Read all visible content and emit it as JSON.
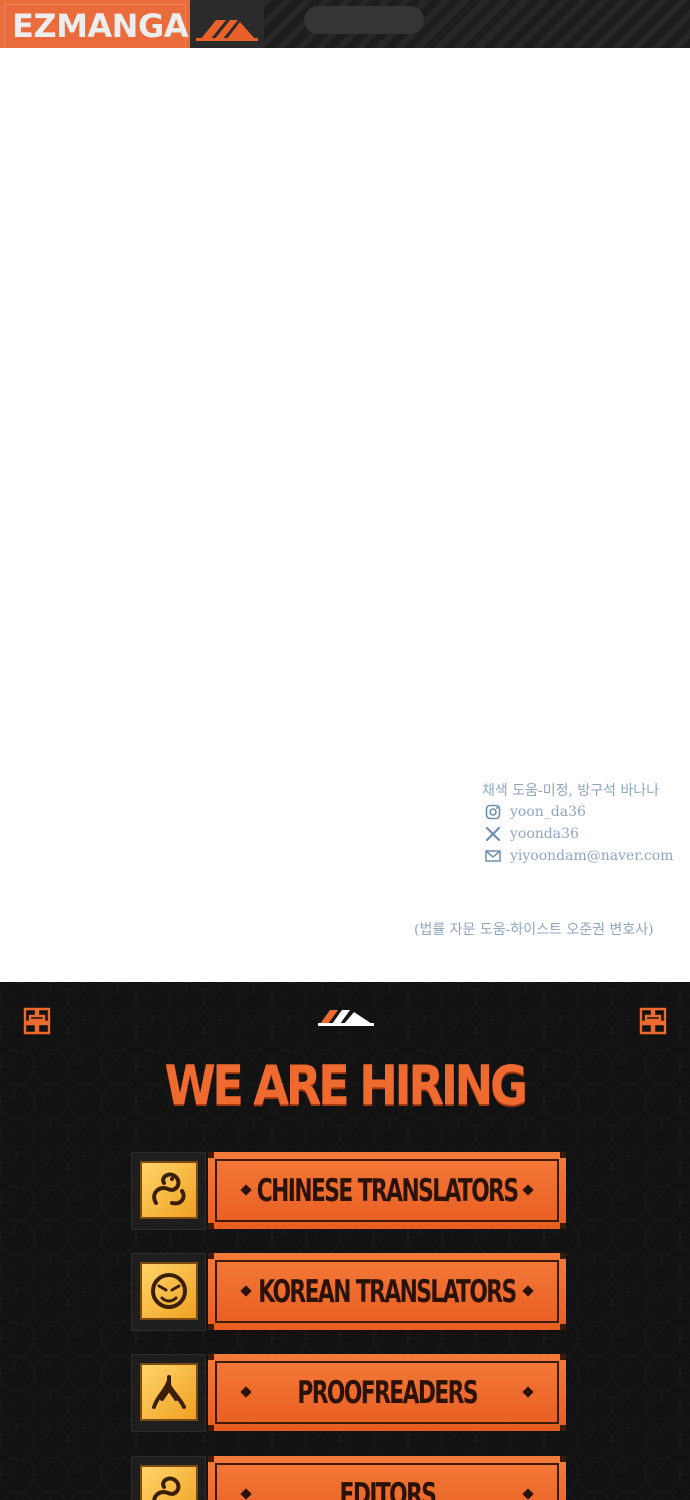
{
  "header": {
    "brand": "EZMANGA",
    "logo_icon": "ez-logo-icon"
  },
  "credits": {
    "assist": "채색 도움-미정, 방구석 바나나",
    "instagram": "yoon_da36",
    "x_handle": "yoonda36",
    "email": "yiyoondam@naver.com",
    "legal": "(법률 자문 도움-하이스트 오준권 변호사)"
  },
  "banner": {
    "title": "WE ARE HIRING",
    "roles": [
      {
        "label": "CHINESE TRANSLATORS",
        "icon": "dragon-icon"
      },
      {
        "label": "KOREAN TRANSLATORS",
        "icon": "tiger-icon"
      },
      {
        "label": "PROOFREADERS",
        "icon": "phoenix-icon"
      },
      {
        "label": "EDITORS",
        "icon": "dragon-icon"
      }
    ]
  },
  "colors": {
    "accent": "#ea6c3d",
    "credit_text": "#8ea6c0",
    "banner_bg": "#121212",
    "plate": "#f06a2c",
    "plate_text": "#2a1206"
  }
}
